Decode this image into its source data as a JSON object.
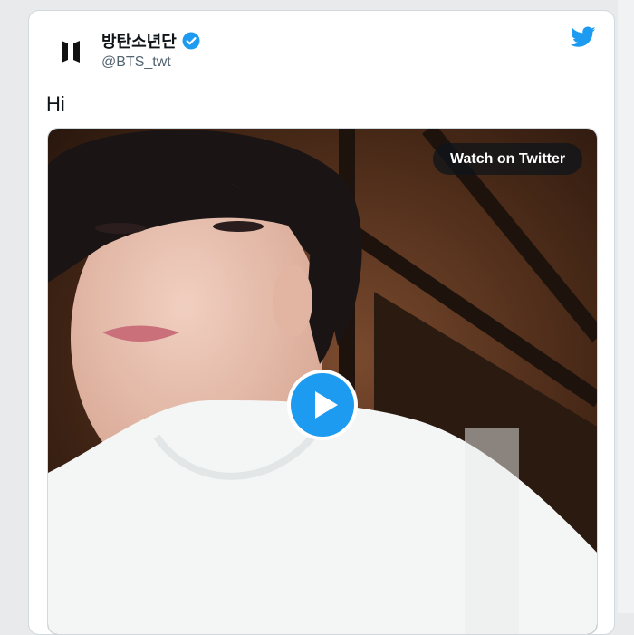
{
  "tweet": {
    "author_name": "방탄소년단",
    "handle": "@BTS_twt",
    "verified": true,
    "text": "Hi",
    "watch_label": "Watch on Twitter"
  },
  "icons": {
    "avatar": "bts-logo-icon",
    "verified": "verified-badge-icon",
    "brand": "twitter-bird-icon",
    "play": "play-icon"
  },
  "colors": {
    "twitter_blue": "#1d9bf0",
    "text_primary": "#0f1419",
    "text_secondary": "#536471"
  }
}
